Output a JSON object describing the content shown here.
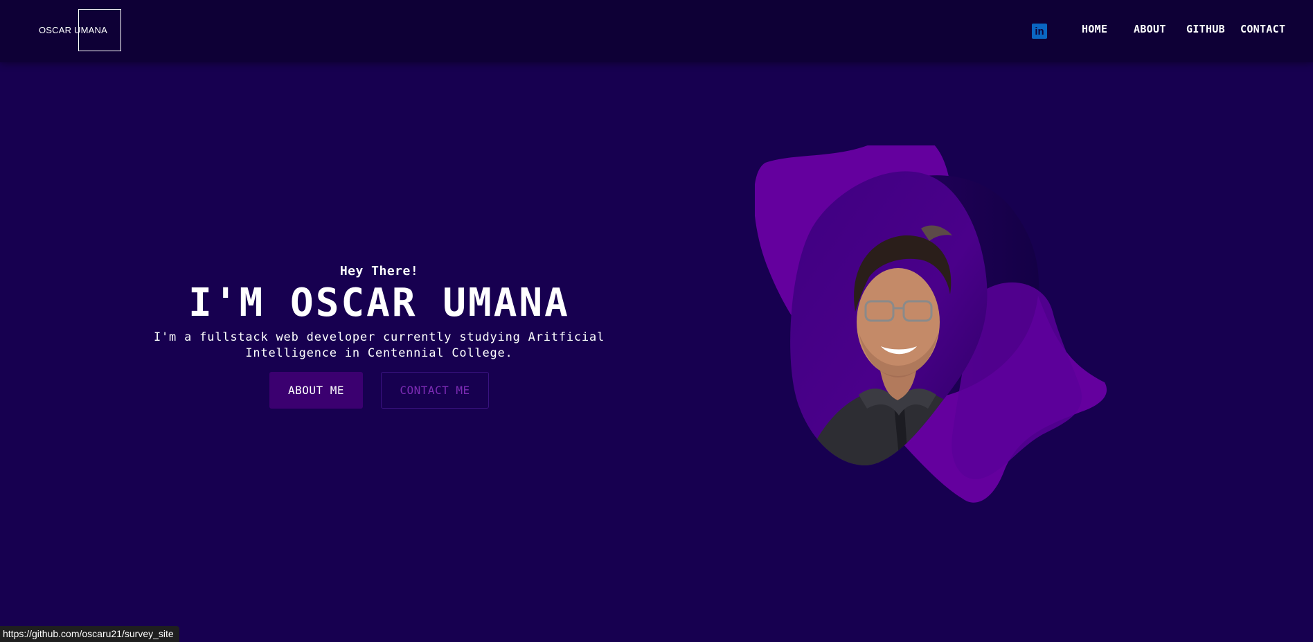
{
  "header": {
    "brand": "OSCAR UMANA",
    "social_icon": "linkedin-icon",
    "social_glyph": "in",
    "nav": {
      "home": "HOME",
      "about": "ABOUT",
      "github": "GITHUB",
      "contact": "CONTACT"
    }
  },
  "hero": {
    "greeting": "Hey There!",
    "name": "I'M OSCAR UMANA",
    "tagline": "I'm a fullstack web developer currently studying Aritficial Intelligence in Centennial College.",
    "primary_button": "ABOUT ME",
    "secondary_button": "CONTACT ME"
  },
  "status_bar": {
    "url": "https://github.com/oscaru21/survey_site"
  },
  "colors": {
    "background": "#170050",
    "navbar": "#0e0036",
    "blob": "#64009e",
    "primary_button": "#3b0070",
    "secondary_text": "#7d2bb5",
    "linkedin": "#0a66c2"
  }
}
